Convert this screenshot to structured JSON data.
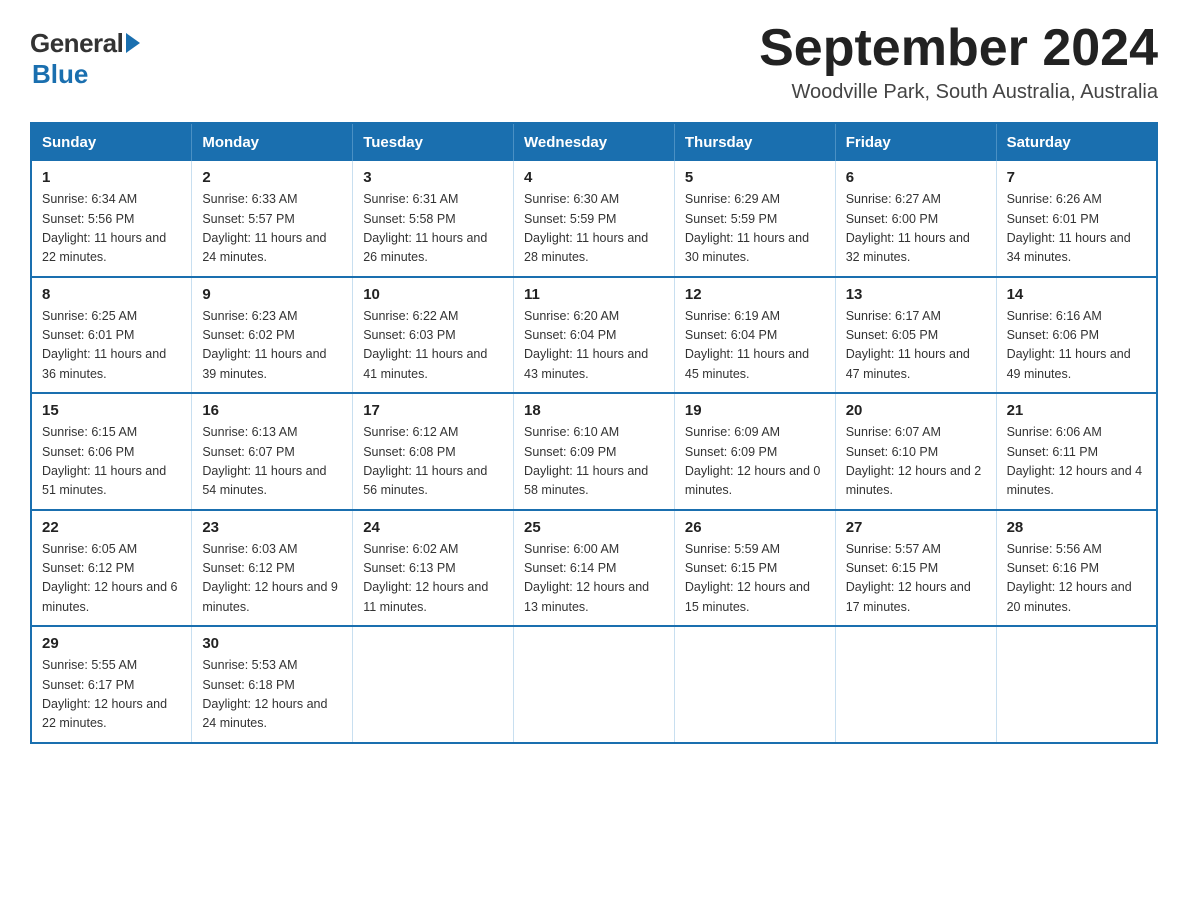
{
  "logo": {
    "general": "General",
    "blue": "Blue"
  },
  "title": "September 2024",
  "subtitle": "Woodville Park, South Australia, Australia",
  "header_days": [
    "Sunday",
    "Monday",
    "Tuesday",
    "Wednesday",
    "Thursday",
    "Friday",
    "Saturday"
  ],
  "weeks": [
    [
      {
        "day": "1",
        "sunrise": "6:34 AM",
        "sunset": "5:56 PM",
        "daylight": "11 hours and 22 minutes."
      },
      {
        "day": "2",
        "sunrise": "6:33 AM",
        "sunset": "5:57 PM",
        "daylight": "11 hours and 24 minutes."
      },
      {
        "day": "3",
        "sunrise": "6:31 AM",
        "sunset": "5:58 PM",
        "daylight": "11 hours and 26 minutes."
      },
      {
        "day": "4",
        "sunrise": "6:30 AM",
        "sunset": "5:59 PM",
        "daylight": "11 hours and 28 minutes."
      },
      {
        "day": "5",
        "sunrise": "6:29 AM",
        "sunset": "5:59 PM",
        "daylight": "11 hours and 30 minutes."
      },
      {
        "day": "6",
        "sunrise": "6:27 AM",
        "sunset": "6:00 PM",
        "daylight": "11 hours and 32 minutes."
      },
      {
        "day": "7",
        "sunrise": "6:26 AM",
        "sunset": "6:01 PM",
        "daylight": "11 hours and 34 minutes."
      }
    ],
    [
      {
        "day": "8",
        "sunrise": "6:25 AM",
        "sunset": "6:01 PM",
        "daylight": "11 hours and 36 minutes."
      },
      {
        "day": "9",
        "sunrise": "6:23 AM",
        "sunset": "6:02 PM",
        "daylight": "11 hours and 39 minutes."
      },
      {
        "day": "10",
        "sunrise": "6:22 AM",
        "sunset": "6:03 PM",
        "daylight": "11 hours and 41 minutes."
      },
      {
        "day": "11",
        "sunrise": "6:20 AM",
        "sunset": "6:04 PM",
        "daylight": "11 hours and 43 minutes."
      },
      {
        "day": "12",
        "sunrise": "6:19 AM",
        "sunset": "6:04 PM",
        "daylight": "11 hours and 45 minutes."
      },
      {
        "day": "13",
        "sunrise": "6:17 AM",
        "sunset": "6:05 PM",
        "daylight": "11 hours and 47 minutes."
      },
      {
        "day": "14",
        "sunrise": "6:16 AM",
        "sunset": "6:06 PM",
        "daylight": "11 hours and 49 minutes."
      }
    ],
    [
      {
        "day": "15",
        "sunrise": "6:15 AM",
        "sunset": "6:06 PM",
        "daylight": "11 hours and 51 minutes."
      },
      {
        "day": "16",
        "sunrise": "6:13 AM",
        "sunset": "6:07 PM",
        "daylight": "11 hours and 54 minutes."
      },
      {
        "day": "17",
        "sunrise": "6:12 AM",
        "sunset": "6:08 PM",
        "daylight": "11 hours and 56 minutes."
      },
      {
        "day": "18",
        "sunrise": "6:10 AM",
        "sunset": "6:09 PM",
        "daylight": "11 hours and 58 minutes."
      },
      {
        "day": "19",
        "sunrise": "6:09 AM",
        "sunset": "6:09 PM",
        "daylight": "12 hours and 0 minutes."
      },
      {
        "day": "20",
        "sunrise": "6:07 AM",
        "sunset": "6:10 PM",
        "daylight": "12 hours and 2 minutes."
      },
      {
        "day": "21",
        "sunrise": "6:06 AM",
        "sunset": "6:11 PM",
        "daylight": "12 hours and 4 minutes."
      }
    ],
    [
      {
        "day": "22",
        "sunrise": "6:05 AM",
        "sunset": "6:12 PM",
        "daylight": "12 hours and 6 minutes."
      },
      {
        "day": "23",
        "sunrise": "6:03 AM",
        "sunset": "6:12 PM",
        "daylight": "12 hours and 9 minutes."
      },
      {
        "day": "24",
        "sunrise": "6:02 AM",
        "sunset": "6:13 PM",
        "daylight": "12 hours and 11 minutes."
      },
      {
        "day": "25",
        "sunrise": "6:00 AM",
        "sunset": "6:14 PM",
        "daylight": "12 hours and 13 minutes."
      },
      {
        "day": "26",
        "sunrise": "5:59 AM",
        "sunset": "6:15 PM",
        "daylight": "12 hours and 15 minutes."
      },
      {
        "day": "27",
        "sunrise": "5:57 AM",
        "sunset": "6:15 PM",
        "daylight": "12 hours and 17 minutes."
      },
      {
        "day": "28",
        "sunrise": "5:56 AM",
        "sunset": "6:16 PM",
        "daylight": "12 hours and 20 minutes."
      }
    ],
    [
      {
        "day": "29",
        "sunrise": "5:55 AM",
        "sunset": "6:17 PM",
        "daylight": "12 hours and 22 minutes."
      },
      {
        "day": "30",
        "sunrise": "5:53 AM",
        "sunset": "6:18 PM",
        "daylight": "12 hours and 24 minutes."
      },
      null,
      null,
      null,
      null,
      null
    ]
  ],
  "labels": {
    "sunrise": "Sunrise:",
    "sunset": "Sunset:",
    "daylight": "Daylight:"
  }
}
